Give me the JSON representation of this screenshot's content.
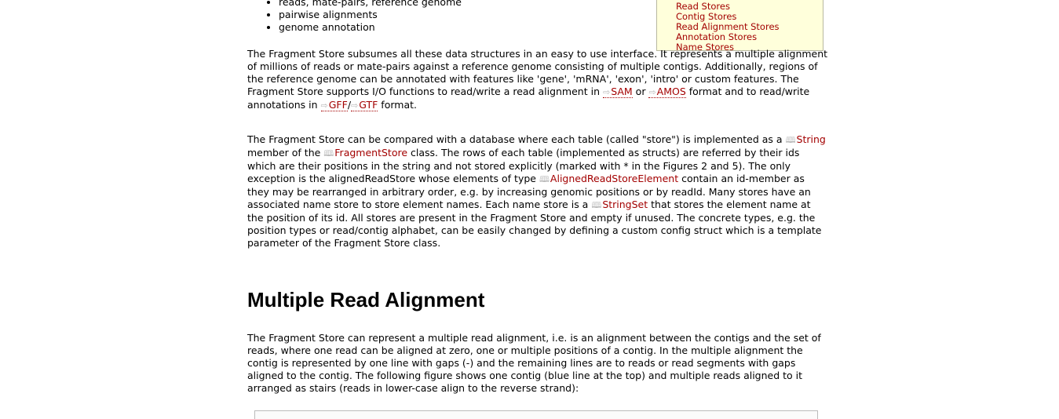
{
  "bullets": [
    "reads, mate-pairs, reference genome",
    "pairwise alignments",
    "genome annotation"
  ],
  "toc": [
    "Read Stores",
    "Contig Stores",
    "Read Alignment Stores",
    "Annotation Stores",
    "Name Stores"
  ],
  "p1": {
    "t1": "The Fragment Store subsumes all these data structures in an easy to use interface. It represents a multiple alignment of millions of reads or mate-pairs against a reference genome consisting of multiple contigs. Additionally, regions of the reference genome can be annotated with features like 'gene', 'mRNA', 'exon', 'intro' or custom features. The Fragment Store supports I/O functions to read/write a read alignment in ",
    "sam": "SAM",
    "t2": " or ",
    "amos": "AMOS",
    "t3": " format and to read/write annotations in ",
    "gff": "GFF",
    "slash": "/",
    "gtf": "GTF",
    "t4": " format."
  },
  "p2": {
    "t1": "The Fragment Store can be compared with a database where each table (called \"store\") is implemented as a ",
    "string": "String",
    "t2": " member of the ",
    "fragmentstore": "FragmentStore",
    "t3": " class. The rows of each table (implemented as structs) are referred by their ids which are their positions in the string and not stored explicitly (marked with * in the Figures 2 and 5). The only exception is the alignedReadStore whose elements of type ",
    "alignedreadstoreelement": "AlignedReadStoreElement",
    "t4": " contain an id-member as they may be rearranged in arbitrary order, e.g. by increasing genomic positions or by readId. Many stores have an associated name store to store element names. Each name store is a ",
    "stringset": "StringSet",
    "t5": " that stores the element name at the position of its id. All stores are present in the Fragment Store and empty if unused. The concrete types, e.g. the position types or read/contig alphabet, can be easily changed by defining a custom config struct which is a template parameter of the Fragment Store class."
  },
  "heading": "Multiple Read Alignment",
  "p3": "The Fragment Store can represent a multiple read alignment, i.e. is an alignment between the contigs and the set of reads, where one read can be aligned at zero, one or multiple positions of a contig. In the multiple alignment the contig is represented by one line with gaps (-) and the remaining lines are to reads or read segments with gaps aligned to the contig. The following figure shows one contig (blue line at the top) and multiple reads aligned to it arranged as stairs (reads in lower-case align to the reverse strand):",
  "icons": {
    "external": "⇨",
    "doc": "🕮"
  }
}
